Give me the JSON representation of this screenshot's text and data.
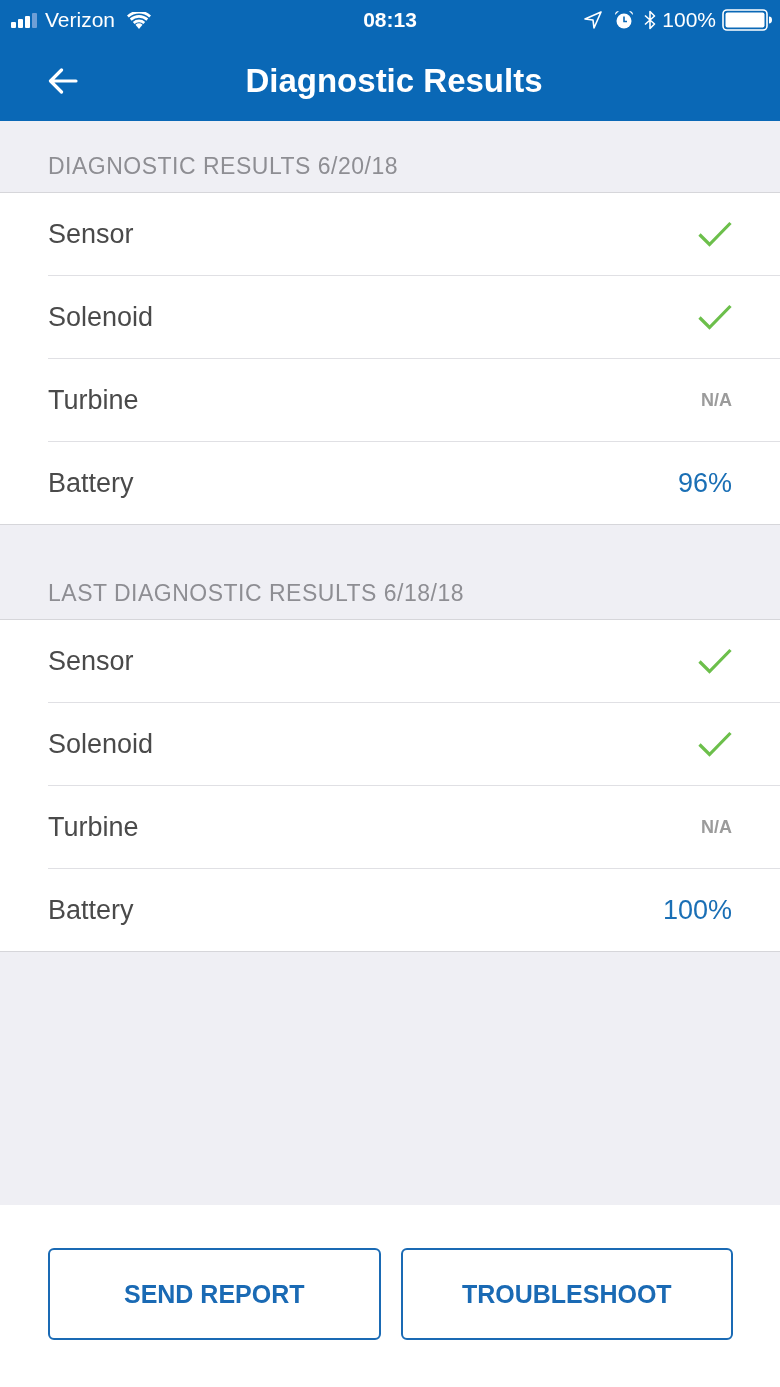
{
  "status_bar": {
    "carrier": "Verizon",
    "time": "08:13",
    "battery": "100%"
  },
  "header": {
    "title": "Diagnostic Results"
  },
  "sections": [
    {
      "title": "DIAGNOSTIC RESULTS 6/20/18",
      "rows": [
        {
          "label": "Sensor",
          "kind": "check"
        },
        {
          "label": "Solenoid",
          "kind": "check"
        },
        {
          "label": "Turbine",
          "kind": "na",
          "value": "N/A"
        },
        {
          "label": "Battery",
          "kind": "percent",
          "value": "96%"
        }
      ]
    },
    {
      "title": "LAST DIAGNOSTIC RESULTS 6/18/18",
      "rows": [
        {
          "label": "Sensor",
          "kind": "check"
        },
        {
          "label": "Solenoid",
          "kind": "check"
        },
        {
          "label": "Turbine",
          "kind": "na",
          "value": "N/A"
        },
        {
          "label": "Battery",
          "kind": "percent",
          "value": "100%"
        }
      ]
    }
  ],
  "buttons": [
    "SEND REPORT",
    "TROUBLESHOOT"
  ]
}
